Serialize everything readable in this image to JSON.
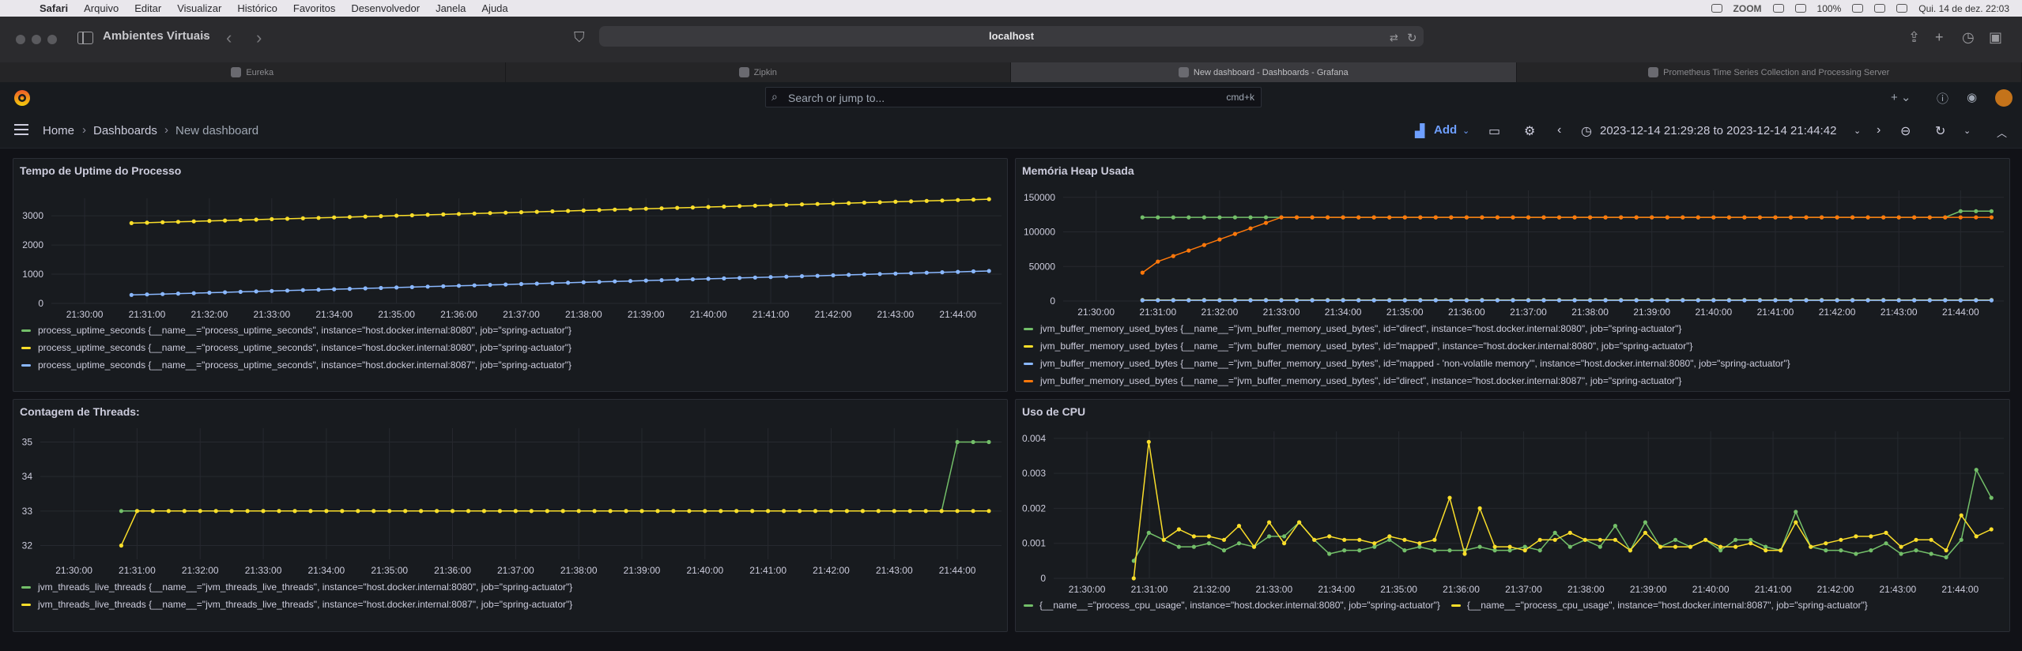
{
  "menubar": {
    "app": "Safari",
    "items": [
      "Arquivo",
      "Editar",
      "Visualizar",
      "Histórico",
      "Favoritos",
      "Desenvolvedor",
      "Janela",
      "Ajuda"
    ],
    "zoom": "ZOOM",
    "battery": "100%",
    "datetime": "Qui. 14 de dez.  22:03"
  },
  "safari": {
    "group": "Ambientes Virtuais",
    "address": "localhost",
    "tabs": [
      {
        "label": "Eureka",
        "active": false
      },
      {
        "label": "Zipkin",
        "active": false
      },
      {
        "label": "New dashboard - Dashboards - Grafana",
        "active": true
      },
      {
        "label": "Prometheus Time Series Collection and Processing Server",
        "active": false
      }
    ]
  },
  "grafana": {
    "search_placeholder": "Search or jump to...",
    "search_shortcut": "cmd+k",
    "breadcrumb": [
      "Home",
      "Dashboards",
      "New dashboard"
    ],
    "add_label": "Add",
    "time_range": "2023-12-14 21:29:28 to 2023-12-14 21:44:42"
  },
  "panels": {
    "uptime": {
      "title": "Tempo de Uptime do Processo",
      "chart_data": {
        "type": "line",
        "x_ticks": [
          "21:30:00",
          "21:31:00",
          "21:32:00",
          "21:33:00",
          "21:34:00",
          "21:35:00",
          "21:36:00",
          "21:37:00",
          "21:38:00",
          "21:39:00",
          "21:40:00",
          "21:41:00",
          "21:42:00",
          "21:43:00",
          "21:44:00"
        ],
        "y_ticks": [
          "0",
          "1000",
          "2000",
          "3000"
        ],
        "ylim": [
          0,
          3600
        ],
        "series": [
          {
            "name": "process_uptime_seconds {__name__=\"process_uptime_seconds\", instance=\"host.docker.internal:8080\", job=\"spring-actuator\"}",
            "color": "#73bf69",
            "x": [],
            "y": []
          },
          {
            "name": "process_uptime_seconds {__name__=\"process_uptime_seconds\", instance=\"host.docker.internal:8080\", job=\"spring-actuator\"}",
            "color": "#fade2a",
            "x": [
              "21:30:45",
              "21:44:30"
            ],
            "y": [
              2750,
              3570
            ]
          },
          {
            "name": "process_uptime_seconds {__name__=\"process_uptime_seconds\", instance=\"host.docker.internal:8087\", job=\"spring-actuator\"}",
            "color": "#8ab8ff",
            "x": [
              "21:30:45",
              "21:44:30"
            ],
            "y": [
              290,
              1110
            ]
          }
        ]
      }
    },
    "heap": {
      "title": "Memória Heap Usada",
      "chart_data": {
        "type": "line",
        "x_ticks": [
          "21:30:00",
          "21:31:00",
          "21:32:00",
          "21:33:00",
          "21:34:00",
          "21:35:00",
          "21:36:00",
          "21:37:00",
          "21:38:00",
          "21:39:00",
          "21:40:00",
          "21:41:00",
          "21:42:00",
          "21:43:00",
          "21:44:00"
        ],
        "y_ticks": [
          "0",
          "50000",
          "100000",
          "150000"
        ],
        "ylim": [
          0,
          160000
        ],
        "series": [
          {
            "name": "jvm_buffer_memory_used_bytes {__name__=\"jvm_buffer_memory_used_bytes\", id=\"direct\", instance=\"host.docker.internal:8080\", job=\"spring-actuator\"}",
            "color": "#73bf69",
            "points": [
              [
                "21:30:45",
                121000
              ],
              [
                "21:33:00",
                121000
              ],
              [
                "21:43:45",
                121000
              ],
              [
                "21:44:00",
                130000
              ],
              [
                "21:44:30",
                130000
              ]
            ]
          },
          {
            "name": "jvm_buffer_memory_used_bytes {__name__=\"jvm_buffer_memory_used_bytes\", id=\"mapped\", instance=\"host.docker.internal:8080\", job=\"spring-actuator\"}",
            "color": "#fade2a",
            "points": [
              [
                "21:30:45",
                1500
              ],
              [
                "21:44:30",
                1500
              ]
            ]
          },
          {
            "name": "jvm_buffer_memory_used_bytes {__name__=\"jvm_buffer_memory_used_bytes\", id=\"mapped - 'non-volatile memory'\", instance=\"host.docker.internal:8080\", job=\"spring-actuator\"}",
            "color": "#8ab8ff",
            "points": [
              [
                "21:30:45",
                1000
              ],
              [
                "21:44:30",
                1000
              ]
            ]
          },
          {
            "name": "jvm_buffer_memory_used_bytes {__name__=\"jvm_buffer_memory_used_bytes\", id=\"direct\", instance=\"host.docker.internal:8087\", job=\"spring-actuator\"}",
            "color": "#ff780a",
            "points": [
              [
                "21:30:45",
                41000
              ],
              [
                "21:31:00",
                57000
              ],
              [
                "21:31:15",
                65000
              ],
              [
                "21:31:30",
                73000
              ],
              [
                "21:31:45",
                81000
              ],
              [
                "21:32:00",
                89000
              ],
              [
                "21:32:15",
                97000
              ],
              [
                "21:32:30",
                105000
              ],
              [
                "21:32:45",
                113000
              ],
              [
                "21:33:00",
                121000
              ],
              [
                "21:44:30",
                121000
              ]
            ]
          }
        ]
      }
    },
    "threads": {
      "title": "Contagem de Threads:",
      "chart_data": {
        "type": "line",
        "x_ticks": [
          "21:30:00",
          "21:31:00",
          "21:32:00",
          "21:33:00",
          "21:34:00",
          "21:35:00",
          "21:36:00",
          "21:37:00",
          "21:38:00",
          "21:39:00",
          "21:40:00",
          "21:41:00",
          "21:42:00",
          "21:43:00",
          "21:44:00"
        ],
        "y_ticks": [
          "32",
          "33",
          "34",
          "35"
        ],
        "ylim": [
          31.6,
          35.4
        ],
        "series": [
          {
            "name": "jvm_threads_live_threads {__name__=\"jvm_threads_live_threads\", instance=\"host.docker.internal:8080\", job=\"spring-actuator\"}",
            "color": "#73bf69",
            "points": [
              [
                "21:30:45",
                33
              ],
              [
                "21:43:45",
                33
              ],
              [
                "21:44:00",
                35
              ],
              [
                "21:44:30",
                35
              ]
            ]
          },
          {
            "name": "jvm_threads_live_threads {__name__=\"jvm_threads_live_threads\", instance=\"host.docker.internal:8087\", job=\"spring-actuator\"}",
            "color": "#fade2a",
            "points": [
              [
                "21:30:45",
                32
              ],
              [
                "21:31:00",
                33
              ],
              [
                "21:44:30",
                33
              ]
            ]
          }
        ]
      }
    },
    "cpu": {
      "title": "Uso de CPU",
      "chart_data": {
        "type": "line",
        "x_ticks": [
          "21:30:00",
          "21:31:00",
          "21:32:00",
          "21:33:00",
          "21:34:00",
          "21:35:00",
          "21:36:00",
          "21:37:00",
          "21:38:00",
          "21:39:00",
          "21:40:00",
          "21:41:00",
          "21:42:00",
          "21:43:00",
          "21:44:00"
        ],
        "y_ticks": [
          "0",
          "0.001",
          "0.002",
          "0.003",
          "0.004"
        ],
        "ylim": [
          0,
          0.0042
        ],
        "series": [
          {
            "name": "{__name__=\"process_cpu_usage\", instance=\"host.docker.internal:8080\", job=\"spring-actuator\"}",
            "color": "#73bf69",
            "y": [
              0.0005,
              0.0013,
              0.0011,
              0.0009,
              0.0009,
              0.001,
              0.0008,
              0.001,
              0.0009,
              0.0012,
              0.0012,
              0.0016,
              0.0011,
              0.0007,
              0.0008,
              0.0008,
              0.0009,
              0.0011,
              0.0008,
              0.0009,
              0.0008,
              0.0008,
              0.0008,
              0.0009,
              0.0008,
              0.0008,
              0.0009,
              0.0008,
              0.0013,
              0.0009,
              0.0011,
              0.0009,
              0.0015,
              0.0008,
              0.0016,
              0.0009,
              0.0011,
              0.0009,
              0.0011,
              0.0008,
              0.0011,
              0.0011,
              0.0009,
              0.0008,
              0.0019,
              0.0009,
              0.0008,
              0.0008,
              0.0007,
              0.0008,
              0.001,
              0.0007,
              0.0008,
              0.0007,
              0.0006,
              0.0011,
              0.0031,
              0.0023
            ]
          },
          {
            "name": "{__name__=\"process_cpu_usage\", instance=\"host.docker.internal:8087\", job=\"spring-actuator\"}",
            "color": "#fade2a",
            "y": [
              0.0,
              0.0039,
              0.0011,
              0.0014,
              0.0012,
              0.0012,
              0.0011,
              0.0015,
              0.0009,
              0.0016,
              0.001,
              0.0016,
              0.0011,
              0.0012,
              0.0011,
              0.0011,
              0.001,
              0.0012,
              0.0011,
              0.001,
              0.0011,
              0.0023,
              0.0007,
              0.002,
              0.0009,
              0.0009,
              0.0008,
              0.0011,
              0.0011,
              0.0013,
              0.0011,
              0.0011,
              0.0011,
              0.0008,
              0.0013,
              0.0009,
              0.0009,
              0.0009,
              0.0011,
              0.0009,
              0.0009,
              0.001,
              0.0008,
              0.0008,
              0.0016,
              0.0009,
              0.001,
              0.0011,
              0.0012,
              0.0012,
              0.0013,
              0.0009,
              0.0011,
              0.0011,
              0.0008,
              0.0018,
              0.0012,
              0.0014
            ]
          }
        ]
      }
    }
  }
}
